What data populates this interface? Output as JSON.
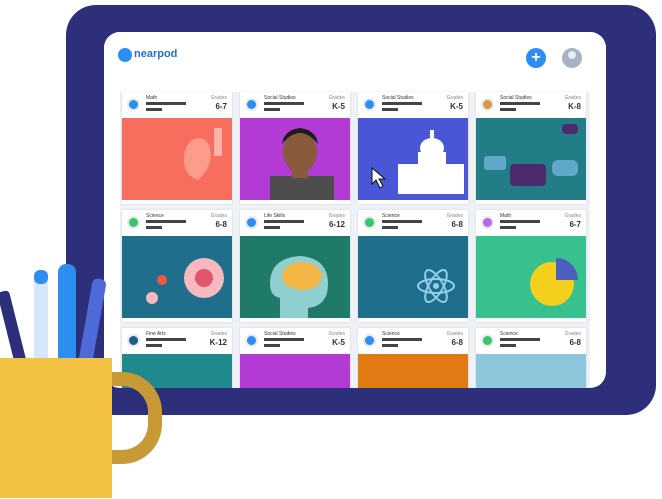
{
  "app": {
    "logo_text": "nearpod"
  },
  "header": {
    "add_icon": "plus-icon",
    "avatar_icon": "user-avatar-icon"
  },
  "grade_label": "Grades",
  "cards": [
    {
      "subject": "Math",
      "grades": "6-7",
      "dot_color": "#2c8ef0",
      "art": "coral-apple"
    },
    {
      "subject": "Social Studies",
      "grades": "K-5",
      "dot_color": "#2c8ef0",
      "art": "portrait"
    },
    {
      "subject": "Social Studies",
      "grades": "K-5",
      "dot_color": "#2c8ef0",
      "art": "capitol"
    },
    {
      "subject": "Social Studies",
      "grades": "K-8",
      "dot_color": "#d89a3d",
      "art": "chat-bubbles"
    },
    {
      "subject": "Science",
      "grades": "6-8",
      "dot_color": "#34c86b",
      "art": "cell"
    },
    {
      "subject": "Life Skills",
      "grades": "6-12",
      "dot_color": "#2c8ef0",
      "art": "brain"
    },
    {
      "subject": "Science",
      "grades": "6-8",
      "dot_color": "#34c86b",
      "art": "atom"
    },
    {
      "subject": "Math",
      "grades": "6-7",
      "dot_color": "#b867e6",
      "art": "pie"
    },
    {
      "subject": "Fine Arts",
      "grades": "K-12",
      "dot_color": "#1e5f8a",
      "art": "teal"
    },
    {
      "subject": "Social Studies",
      "grades": "K-5",
      "dot_color": "#2c8ef0",
      "art": "purple"
    },
    {
      "subject": "Science",
      "grades": "6-8",
      "dot_color": "#2c8ef0",
      "art": "orange"
    },
    {
      "subject": "Science",
      "grades": "6-8",
      "dot_color": "#34c86b",
      "art": "lightblue"
    }
  ]
}
